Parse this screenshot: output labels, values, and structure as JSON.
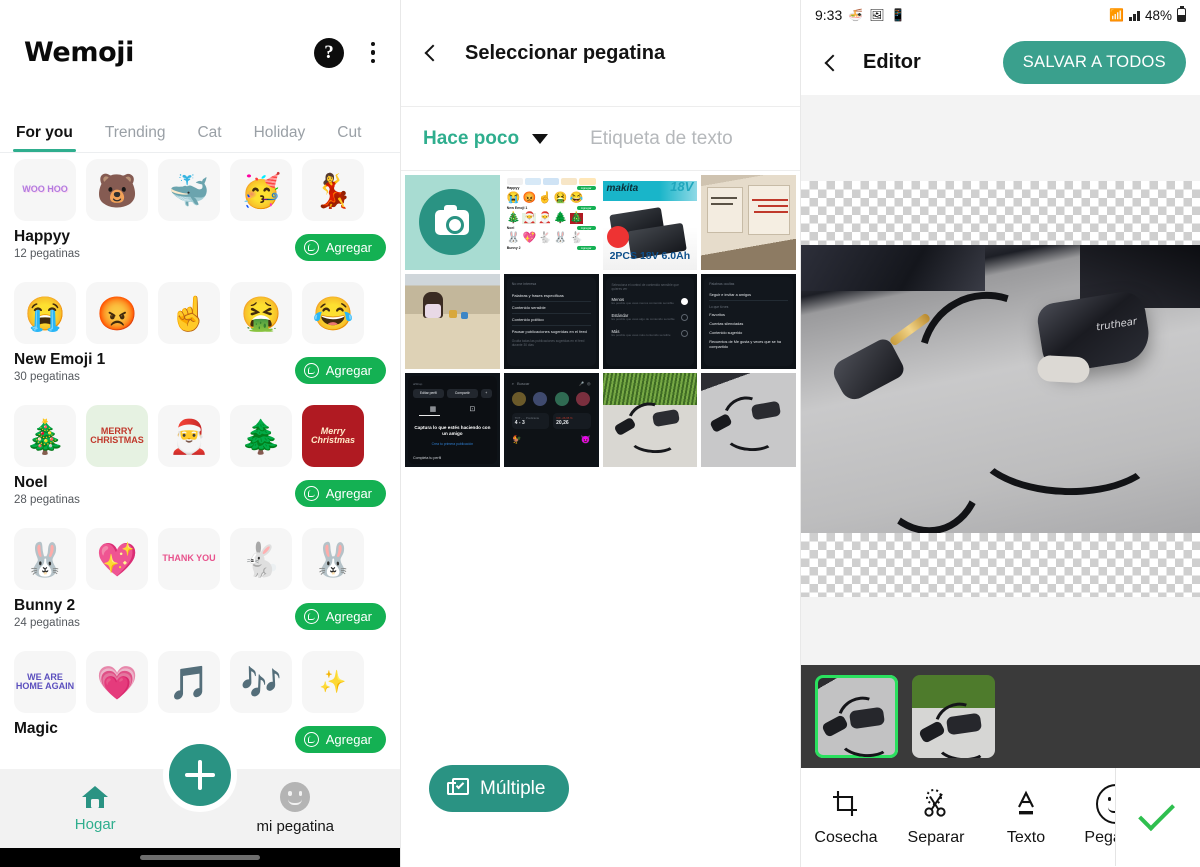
{
  "panel1": {
    "app_title": "Wemoji",
    "help_icon": "help-circle-icon",
    "overflow_icon": "kebab-menu-icon",
    "tabs": [
      {
        "label": "For you",
        "active": true
      },
      {
        "label": "Trending",
        "active": false
      },
      {
        "label": "Cat",
        "active": false
      },
      {
        "label": "Holiday",
        "active": false
      },
      {
        "label": "Cut",
        "active": false
      }
    ],
    "add_label": "Agregar",
    "packs": [
      {
        "name": "Happyy",
        "count": "12 pegatinas",
        "stickers": [
          "WOO HOO",
          "🐻",
          "🐳",
          "🥳",
          "💃"
        ]
      },
      {
        "name": "New Emoji 1",
        "count": "30 pegatinas",
        "stickers": [
          "😭",
          "😡",
          "☝️",
          "🤮",
          "😂"
        ]
      },
      {
        "name": "Noel",
        "count": "28 pegatinas",
        "stickers": [
          "🎄",
          "MERRY CHRISTMAS",
          "🎅",
          "🌲",
          "Merry Christmas"
        ]
      },
      {
        "name": "Bunny 2",
        "count": "24 pegatinas",
        "stickers": [
          "🐰",
          "💖",
          "THANK YOU",
          "🐇",
          "🐰"
        ]
      },
      {
        "name": "Magic",
        "count": "",
        "stickers": [
          "WE ARE HOME AGAIN",
          "💗",
          "🎵",
          "🎶",
          "✨"
        ]
      }
    ],
    "bottom_nav": [
      {
        "label": "Hogar",
        "icon": "home-icon",
        "active": true
      },
      {
        "label": "mi pegatina",
        "icon": "smiley-icon",
        "active": false
      }
    ],
    "fab": {
      "icon": "plus-icon",
      "label": ""
    }
  },
  "panel2": {
    "back_icon": "chevron-left-icon",
    "title": "Seleccionar pegatina",
    "tab_selected": "Hace poco",
    "tab_selected_caret": "caret-down-icon",
    "tab_other": "Etiqueta de texto",
    "camera_cell_icon": "camera-icon",
    "multiple_button": {
      "label": "Múltiple",
      "icon": "multi-select-icon"
    },
    "gallery_items": [
      {
        "kind": "camera",
        "alt": "camera-tile"
      },
      {
        "kind": "screenshot",
        "alt": "wemoji-sticker-list-screenshot"
      },
      {
        "kind": "product",
        "alt": "makita-2pcs-18v-6-0ah-battery-ad"
      },
      {
        "kind": "photo",
        "alt": "handwritten-notes-on-wall"
      },
      {
        "kind": "photo",
        "alt": "child-playing-on-beach"
      },
      {
        "kind": "screenshot",
        "alt": "dark-settings-list-palabras-y-frases"
      },
      {
        "kind": "screenshot",
        "alt": "dark-settings-sensitivity-options"
      },
      {
        "kind": "screenshot",
        "alt": "dark-settings-favoritos-cuentas-silenciadas"
      },
      {
        "kind": "screenshot",
        "alt": "dark-profile-editar-perfil-compartir"
      },
      {
        "kind": "screenshot",
        "alt": "dark-search-widgets-scores"
      },
      {
        "kind": "photo",
        "alt": "earphone-on-desk-with-grass"
      },
      {
        "kind": "photo",
        "alt": "earphone-on-desk"
      }
    ],
    "gallery_texts": {
      "product_headline": "2PCS 18V 6.0Ah",
      "dark_rows": [
        "Palabras y frases específicas",
        "Contenido sensible",
        "Contenido político",
        "Pausar publicaciones sugeridas en el feed"
      ],
      "sensitivity_rows": [
        "Menos",
        "Estándar",
        "Más"
      ],
      "account_rows": [
        "Seguir e invitar a amigos",
        "Favoritos",
        "Cuentas silenciadas",
        "Contenido sugerido",
        "Recuentos de Me gusta y veces que se ha compartido"
      ],
      "profile_buttons": [
        "Editar perfil",
        "Compartir"
      ],
      "profile_headline": "Captura lo que estés haciendo con un amigo",
      "search_placeholder": "Buscar",
      "score": "4 - 3",
      "ticker": "20,26"
    }
  },
  "panel3": {
    "statusbar": {
      "time": "9:33",
      "left_icons": [
        "bowl-icon",
        "image-icon",
        "app-icon"
      ],
      "wifi_icon": "wifi-icon",
      "signal_icon": "signal-bars-icon",
      "battery_text": "48%",
      "battery_icon": "battery-icon"
    },
    "back_icon": "chevron-left-icon",
    "title": "Editor",
    "save_label": "SALVAR A TODOS",
    "canvas_alt": "truthear-earphone-cutout-on-transparent-background",
    "brand_on_earbud": "truthear",
    "thumbnails": [
      {
        "alt": "earphone-on-desk",
        "selected": true
      },
      {
        "alt": "earphone-on-grass",
        "selected": false
      }
    ],
    "tools": [
      {
        "label": "Cosecha",
        "icon": "crop-icon"
      },
      {
        "label": "Separar",
        "icon": "scissors-cut-icon"
      },
      {
        "label": "Texto",
        "icon": "text-icon"
      },
      {
        "label": "Pegatina",
        "icon": "sticker-smiley-icon"
      }
    ],
    "confirm_icon": "check-icon"
  },
  "colors": {
    "teal": "#2a9383",
    "teal_button": "#3aa08d",
    "whatsapp_green": "#14b153",
    "tab_underline": "#2fae8e",
    "check_green": "#2fbf4f",
    "thumb_select_green": "#2ae05e",
    "filmstrip_bg": "#3a3a3a"
  }
}
